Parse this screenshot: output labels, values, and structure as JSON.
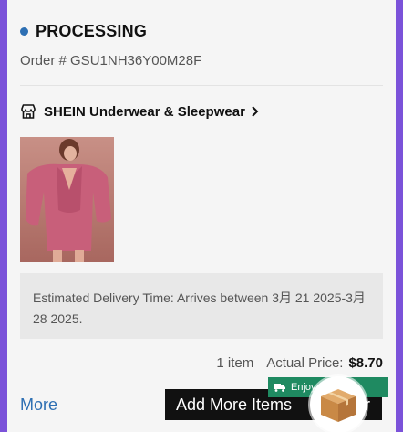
{
  "order": {
    "status": "PROCESSING",
    "order_number": "Order # GSU1NH36Y00M28F"
  },
  "store": {
    "name": "SHEIN Underwear & Sleepwear"
  },
  "delivery": {
    "text": "Estimated Delivery Time: Arrives between 3月 21 2025-3月 28 2025."
  },
  "summary": {
    "item_count": "1 item",
    "price_label": "Actual Price:",
    "price_value": "$8.70"
  },
  "actions": {
    "more_label": "More",
    "add_more_label": "Add More Items",
    "add_more_suffix": "r"
  },
  "promo": {
    "shipping_badge": "Enjoy      Shipping"
  },
  "colors": {
    "accent_blue": "#2d6fb3",
    "badge_green": "#1f8a61",
    "frame_purple": "#7b52d9"
  },
  "icons": {
    "status": "status-dot-icon",
    "store": "store-icon",
    "chevron": "chevron-right-icon",
    "truck": "truck-icon",
    "box": "package-box-icon"
  }
}
